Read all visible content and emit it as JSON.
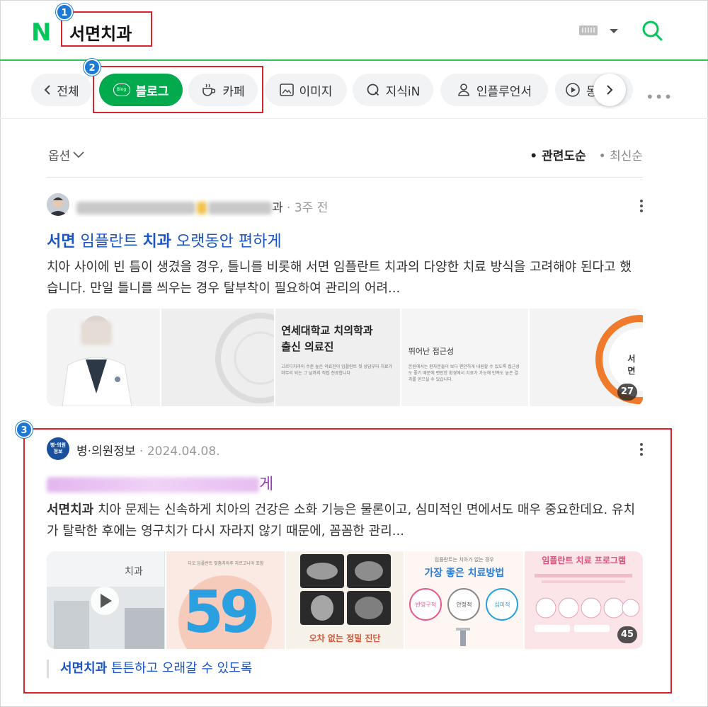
{
  "header": {
    "logo": "N",
    "query": "서면치과"
  },
  "badges": [
    "1",
    "2",
    "3"
  ],
  "tabs": [
    {
      "label": "전체",
      "icon": "chevron-left-icon"
    },
    {
      "label": "블로그",
      "icon": "blog-icon",
      "icon_text": "Blog",
      "active": true
    },
    {
      "label": "카페",
      "icon": "cafe-cup-icon"
    },
    {
      "label": "이미지",
      "icon": "image-icon"
    },
    {
      "label": "지식iN",
      "icon": "q-icon"
    },
    {
      "label": "인플루언서",
      "icon": "person-icon"
    },
    {
      "label": "동",
      "icon": "play-icon"
    }
  ],
  "options_label": "옵션",
  "sort": {
    "relevance": "관련도순",
    "recent": "최신순"
  },
  "result1": {
    "author_suffix": "과",
    "time": "3주 전",
    "title_parts": [
      {
        "text": "서면",
        "bold": true
      },
      {
        "text": " 임플란트 ",
        "bold": false
      },
      {
        "text": "치과",
        "bold": true
      },
      {
        "text": " 오랫동안 편하게",
        "bold": false
      }
    ],
    "desc": "치아 사이에 빈 틈이 생겼을 경우, 틀니를 비롯해 서면 임플란트 치과의 다양한 치료 방식을 고려해야 된다고 했습니다. 만일 틀니를 씌우는 경우 탈부착이 필요하여 관리의 어려...",
    "images": {
      "cell3_title": "연세대학교 치의학과\n출신 의료진",
      "cell3_text": "고르디치과의 수준 높은 의료진이 임플란트 첫 상담부터 치료가 마무리 되는 그 날까지 직접 진료합니다",
      "cell4_title": "뛰어난 접근성",
      "cell4_text": "본원에서는 환자분들이 보다 편안하게 내원할 수 있도록 접근성도 좋기 때문에 편안한 환경에서 치료가 가능해 만족도 높은 결과를 얻으실 수 있습니다.",
      "cell5_title": "서면",
      "count": "27"
    }
  },
  "result2": {
    "author": "병·의원정보",
    "avatar_text": "병·의원\n정보",
    "time": "2024.04.08.",
    "title_suffix": "게",
    "desc_bold": "서면치과",
    "desc": " 치아 문제는 신속하게 치아의 건강은 소화 기능은 물론이고, 심미적인 면에서도 매우 중요한데요. 유치가 탈락한 후에는 영구치가 다시 자라지 않기 때문에, 꼼꼼한 관리...",
    "images": {
      "cell1_sign": "치과",
      "cell2_text": "디오 임플란트 맞춤치아주 자르고니아 포함",
      "cell2_number": "59",
      "cell3_caption": "오차 없는 정밀 진단",
      "cell4_top": "임플란트는 치아가 없는 경우",
      "cell4_title": "가장 좋은 치료방법",
      "cell4_circles": [
        "반영구적",
        "안정적",
        "심미적"
      ],
      "cell5_title": "임플란트 치료 프로그램",
      "count": "45"
    },
    "quote_bold": "서면치과",
    "quote_rest": " 튼튼하고 오래갈 수 있도록"
  },
  "colors": {
    "naver_green": "#03c75a",
    "highlight_red": "#d9232e",
    "badge_blue": "#1b7ad6",
    "link_blue": "#1b54c4"
  }
}
